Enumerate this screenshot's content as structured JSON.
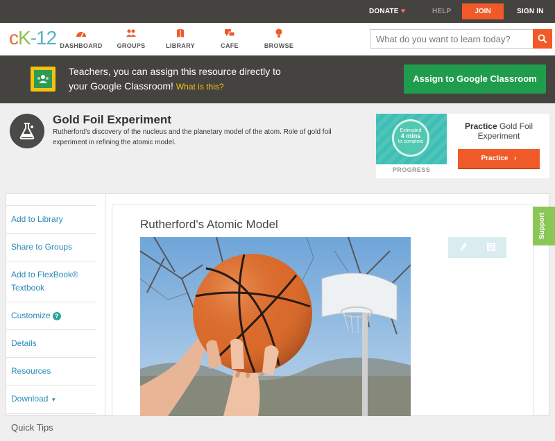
{
  "topbar": {
    "donate": "DONATE",
    "help": "HELP",
    "join": "JOIN",
    "signin": "SIGN IN"
  },
  "logo": {
    "part1": "c",
    "part2": "K",
    "part3": "-12"
  },
  "nav": [
    {
      "label": "DASHBOARD",
      "icon": "dashboard-icon"
    },
    {
      "label": "GROUPS",
      "icon": "groups-icon"
    },
    {
      "label": "LIBRARY",
      "icon": "library-icon"
    },
    {
      "label": "CAFE",
      "icon": "cafe-icon"
    },
    {
      "label": "BROWSE",
      "icon": "browse-icon"
    }
  ],
  "search": {
    "placeholder": "What do you want to learn today?"
  },
  "banner": {
    "line1": "Teachers, you can assign this resource directly to",
    "line2": "your Google Classroom!",
    "link": "What is this?",
    "button": "Assign to Google Classroom"
  },
  "concept": {
    "title": "Gold Foil Experiment",
    "description": "Rutherford's discovery of the nucleus and the planetary model of the atom. Role of gold foil experiment in refining the atomic model."
  },
  "practice": {
    "estimated": "Estimated",
    "mins": "4 mins",
    "to_complete": "to complete",
    "progress_label": "PROGRESS",
    "title_bold": "Practice",
    "title_rest": "Gold Foil Experiment",
    "button": "Practice"
  },
  "sidebar": {
    "items": [
      {
        "label": "Add to Library"
      },
      {
        "label": "Share to Groups"
      },
      {
        "label": "Add to FlexBook®"
      },
      {
        "label": "Textbook"
      },
      {
        "label": "Customize"
      },
      {
        "label": "Details"
      },
      {
        "label": "Resources"
      },
      {
        "label": "Download"
      }
    ],
    "quick_tips": "Quick Tips"
  },
  "article": {
    "title": "Rutherford's Atomic Model"
  },
  "support": "Support",
  "colors": {
    "accent": "#f05a28",
    "dark_bar": "#444340",
    "google_green": "#1f9c4c",
    "link": "#2b8ab8"
  }
}
